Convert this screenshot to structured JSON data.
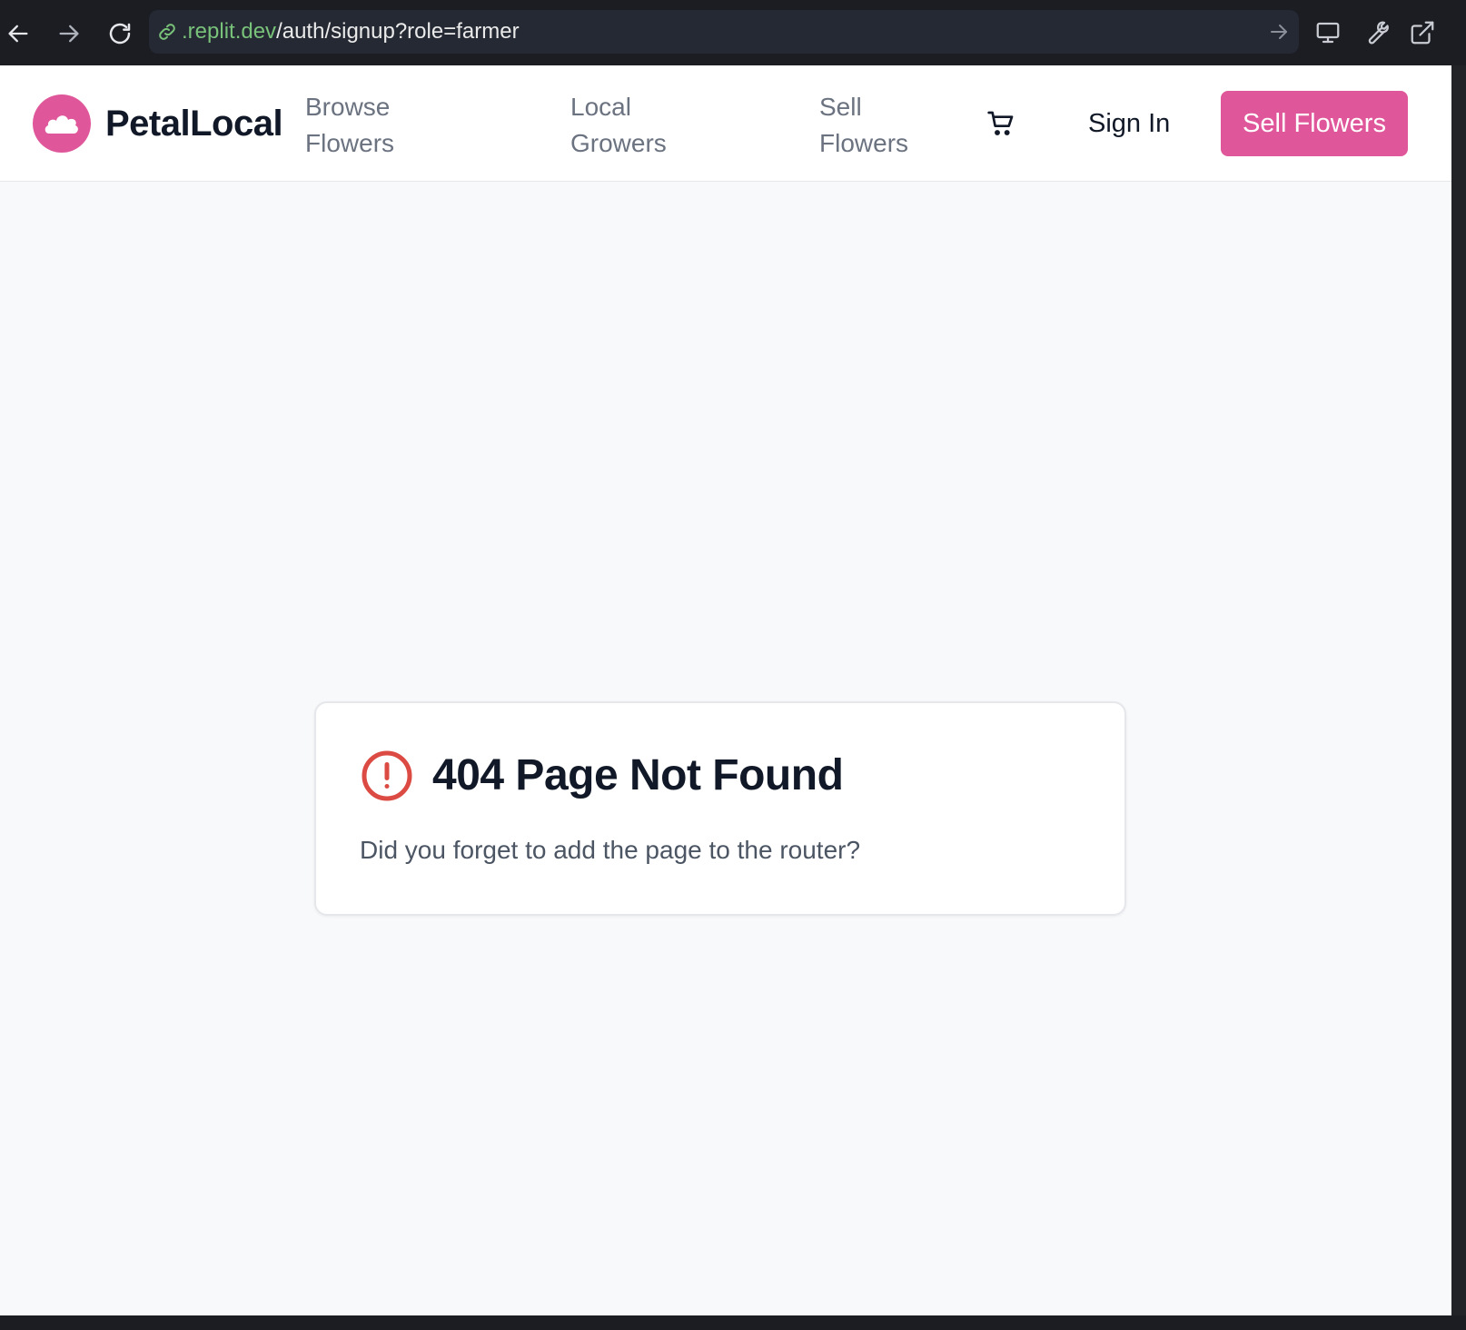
{
  "browser": {
    "url_host": ".replit.dev",
    "url_path": "/auth/signup?role=farmer",
    "icons": {
      "back": "arrow-left-icon",
      "forward": "arrow-right-icon",
      "reload": "reload-icon",
      "link": "link-icon",
      "go": "arrow-right-icon",
      "device": "monitor-icon",
      "devtools": "wrench-icon",
      "open_external": "external-link-icon"
    }
  },
  "header": {
    "brand": "PetalLocal",
    "nav": [
      {
        "line1": "Browse",
        "line2": "Flowers"
      },
      {
        "line1": "Local",
        "line2": "Growers"
      },
      {
        "line1": "Sell",
        "line2": "Flowers"
      }
    ],
    "cart_icon": "shopping-cart-icon",
    "sign_in": "Sign In",
    "cta": "Sell Flowers"
  },
  "error_card": {
    "icon": "alert-circle-icon",
    "title": "404 Page Not Found",
    "message": "Did you forget to add the page to the router?"
  },
  "colors": {
    "brand_pink": "#df579a",
    "error_red": "#dc4b43",
    "url_host_green": "#79c27a",
    "page_background": "#f8f9fb",
    "chrome_background": "#1b1d23"
  }
}
